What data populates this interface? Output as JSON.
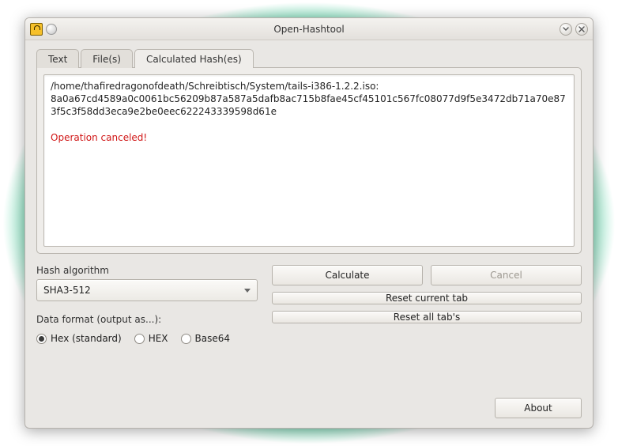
{
  "window": {
    "title": "Open-Hashtool"
  },
  "tabs": {
    "text": "Text",
    "files": "File(s)",
    "calculated": "Calculated Hash(es)"
  },
  "output": {
    "path": "/home/thafiredragonofdeath/Schreibtisch/System/tails-i386-1.2.2.iso:",
    "hash": "8a0a67cd4589a0c0061bc56209b87a587a5dafb8ac715b8fae45cf45101c567fc08077d9f5e3472db71a70e873f5c3f58dd3eca9e2be0eec622243339598d61e",
    "status": "Operation canceled!"
  },
  "algo": {
    "label": "Hash algorithm",
    "selected": "SHA3-512"
  },
  "format": {
    "label": "Data format (output as...):",
    "options": {
      "hex_std": "Hex (standard)",
      "hex_upper": "HEX",
      "base64": "Base64"
    }
  },
  "buttons": {
    "calculate": "Calculate",
    "cancel": "Cancel",
    "reset_current": "Reset current tab",
    "reset_all": "Reset all tab's",
    "about": "About"
  }
}
